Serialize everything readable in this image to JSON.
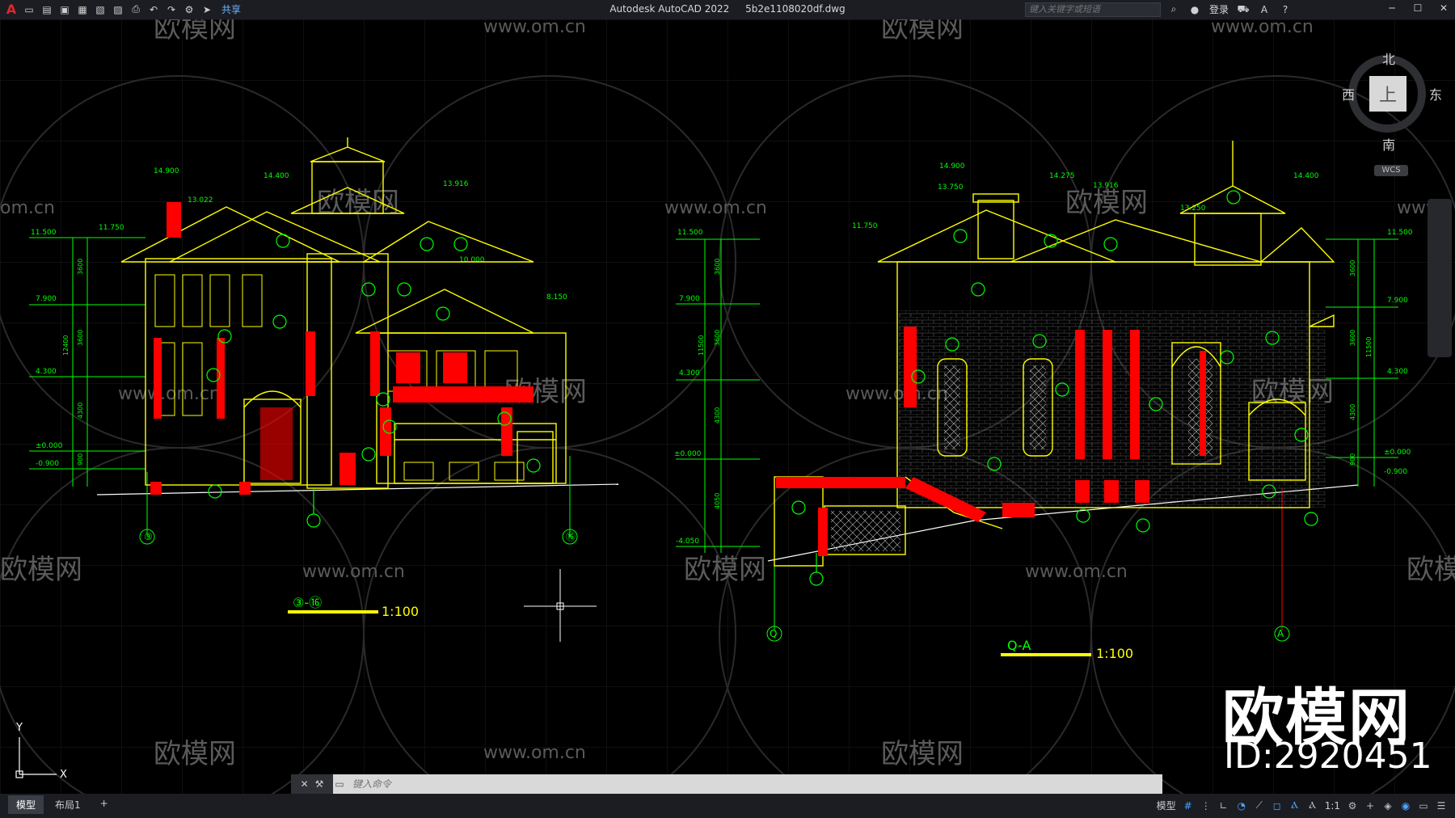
{
  "app": {
    "product": "Autodesk AutoCAD 2022",
    "filename": "5b2e1108020df.dwg",
    "share_label": "共享",
    "search_placeholder": "键入关键字或短语",
    "login_label": "登录"
  },
  "viewcube": {
    "north": "北",
    "south": "南",
    "east": "东",
    "west": "西",
    "face": "上",
    "wcs": "WCS"
  },
  "command": {
    "placeholder": "键入命令"
  },
  "tabs": [
    {
      "label": "模型"
    },
    {
      "label": "布局1"
    }
  ],
  "status": {
    "model_label": "模型",
    "scale_label": "1:1"
  },
  "watermarks": {
    "brand": "欧模网",
    "site": "www.om.cn",
    "site_fragment": "om.cn",
    "site_fragment2": "www.",
    "id_text": "ID:2920451"
  },
  "drawing": {
    "left_elevation": {
      "title": "③-⑯",
      "scale": "1:100",
      "axis_left": "③",
      "axis_right": "⑯",
      "levels": [
        "14.900",
        "14.400",
        "13.916",
        "13.022",
        "11.500",
        "11.750",
        "10.000",
        "8.150",
        "7.900",
        "4.300",
        "±0.000",
        "-0.900"
      ],
      "dims": [
        "3600",
        "3600",
        "12400",
        "4300",
        "900"
      ]
    },
    "right_elevation": {
      "title": "Q-A",
      "scale": "1:100",
      "axis_left": "Q",
      "axis_right": "A",
      "levels": [
        "14.900",
        "13.750",
        "14.275",
        "13.916",
        "13.250",
        "14.400",
        "11.500",
        "11.750",
        "11.500",
        "7.900",
        "7.900",
        "4.300",
        "4.300",
        "±0.000",
        "±0.000",
        "-0.900",
        "-4.050"
      ],
      "dims": [
        "3600",
        "3600",
        "11500",
        "4300",
        "4050",
        "11500",
        "3600",
        "3600",
        "4300",
        "900"
      ]
    }
  },
  "ucs": {
    "x": "X",
    "y": "Y"
  },
  "colors": {
    "green": "#00ff00",
    "yellow": "#ffff00",
    "red": "#ff0000",
    "grid": "#1a1a1a"
  }
}
